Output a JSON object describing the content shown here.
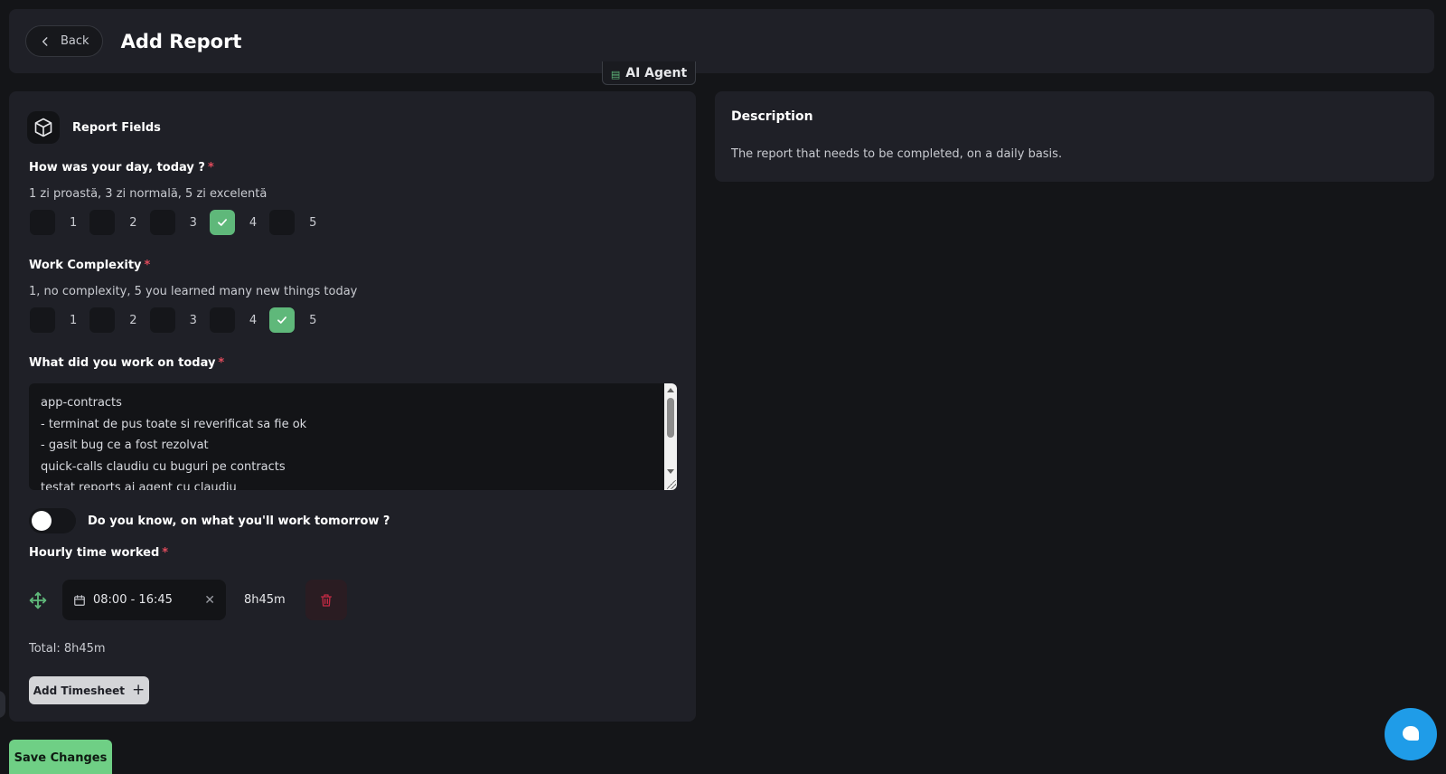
{
  "header": {
    "back_label": "Back",
    "title": "Add Report"
  },
  "ai_agent": {
    "label": "AI Agent"
  },
  "report_fields": {
    "title": "Report Fields",
    "day_rating": {
      "label": "How was your day, today ?",
      "required_mark": "*",
      "help": "1 zi proastă, 3 zi normală, 5 zi excelentă",
      "options": [
        "1",
        "2",
        "3",
        "4",
        "5"
      ],
      "selected": "4"
    },
    "work_complexity": {
      "label": "Work Complexity",
      "required_mark": "*",
      "help": "1, no complexity, 5 you learned many new things today",
      "options": [
        "1",
        "2",
        "3",
        "4",
        "5"
      ],
      "selected": "5"
    },
    "work_today": {
      "label": "What did you work on today",
      "required_mark": "*",
      "value": "app-contracts\n- terminat de pus toate si reverificat sa fie ok\n- gasit bug ce a fost rezolvat\nquick-calls claudiu cu buguri pe contracts\ntestat reports ai agent cu claudiu"
    },
    "tomorrow_toggle": {
      "label": "Do you know, on what you'll work tomorrow ?",
      "enabled": false
    },
    "hourly_time": {
      "label": "Hourly time worked",
      "required_mark": "*",
      "range": "08:00 - 16:45",
      "clear_symbol": "✕",
      "duration": "8h45m",
      "total": "Total: 8h45m"
    },
    "add_timesheet_label": "Add Timesheet",
    "add_timesheet_symbol": "+"
  },
  "description": {
    "title": "Description",
    "text": "The report that needs to be completed, on a daily basis."
  },
  "save_label": "Save Changes",
  "colors": {
    "accent_green": "#5fb87a",
    "save_green": "#6fcf85",
    "required_red": "#e04b5c",
    "delete_red": "#c42a44",
    "chat_blue": "#1f9ce8"
  },
  "icons": {
    "back": "chevron-left-icon",
    "section": "cube-icon",
    "check": "check-icon",
    "move": "move-icon",
    "calendar": "calendar-icon",
    "delete": "trash-icon",
    "chat": "chat-bubble-icon"
  }
}
